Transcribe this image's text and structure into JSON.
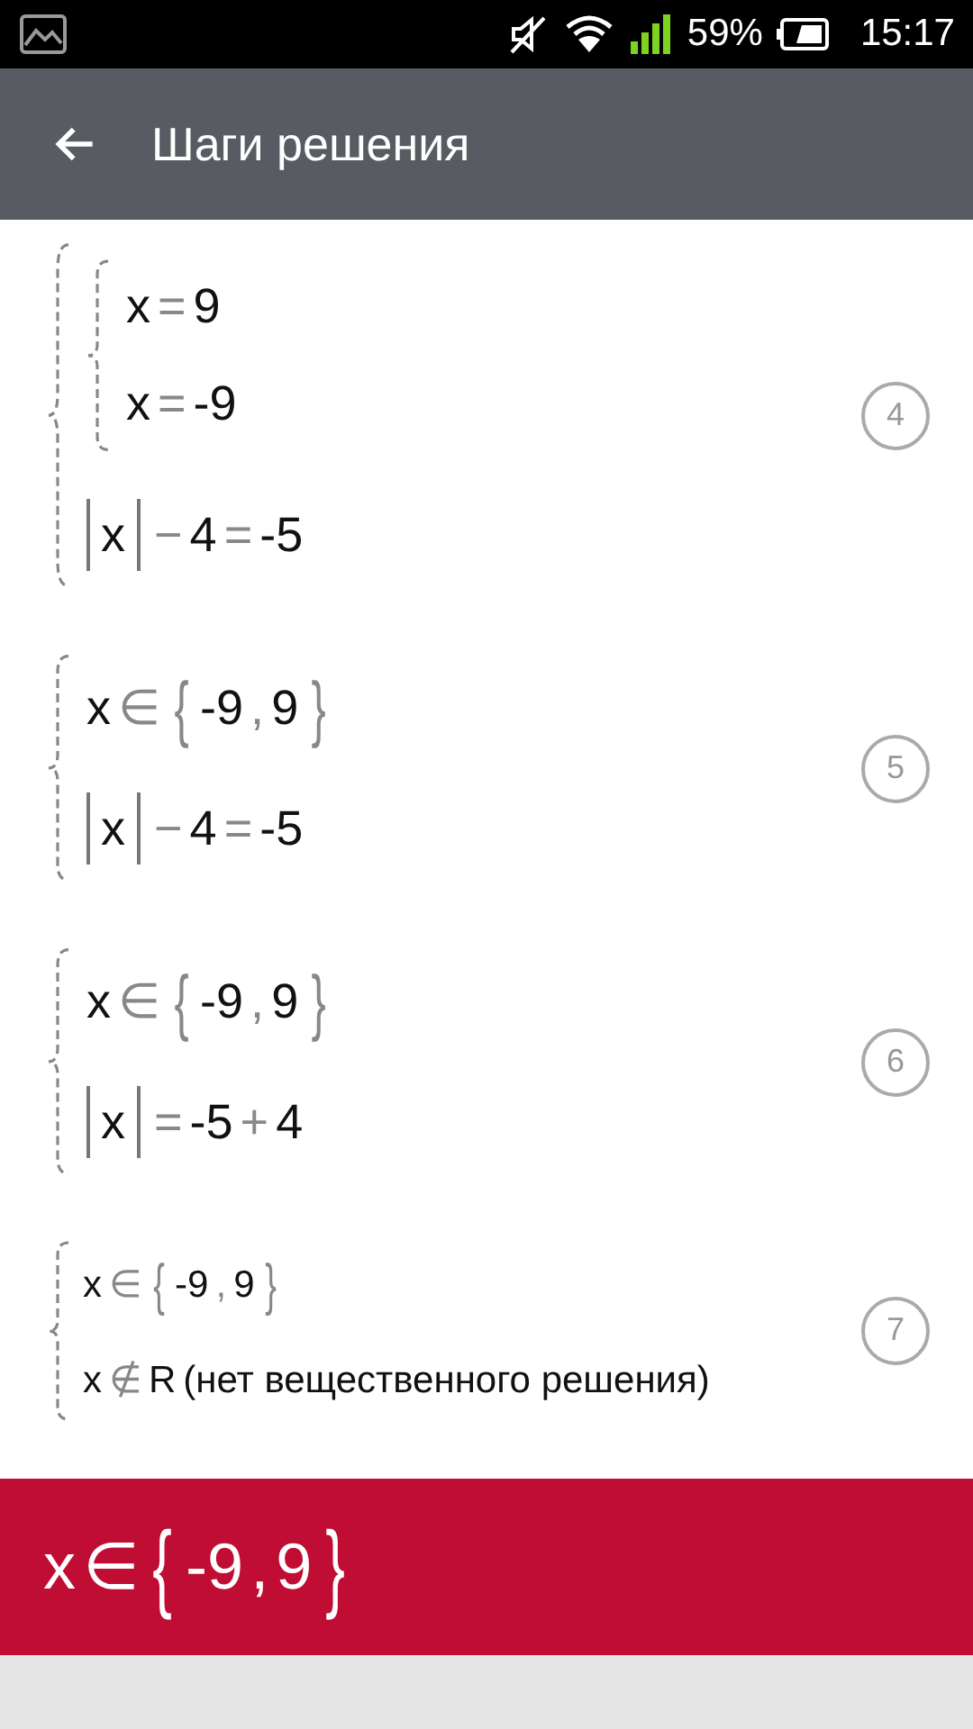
{
  "status_bar": {
    "battery": "59%",
    "time": "15:17"
  },
  "app_bar": {
    "title": "Шаги решения"
  },
  "steps": [
    {
      "number": "4",
      "compact": false,
      "body": {
        "kind": "system",
        "items": [
          {
            "kind": "system",
            "items": [
              {
                "kind": "line",
                "tokens": [
                  {
                    "kind": "term",
                    "text": "x"
                  },
                  {
                    "kind": "op",
                    "text": "="
                  },
                  {
                    "kind": "term",
                    "text": "9"
                  }
                ]
              },
              {
                "kind": "line",
                "tokens": [
                  {
                    "kind": "term",
                    "text": "x"
                  },
                  {
                    "kind": "op",
                    "text": "="
                  },
                  {
                    "kind": "term",
                    "text": "-9"
                  }
                ]
              }
            ]
          },
          {
            "kind": "line",
            "tokens": [
              {
                "kind": "abs",
                "text": "x"
              },
              {
                "kind": "op",
                "text": "−"
              },
              {
                "kind": "term",
                "text": "4"
              },
              {
                "kind": "op",
                "text": "="
              },
              {
                "kind": "term",
                "text": "-5"
              }
            ]
          }
        ]
      }
    },
    {
      "number": "5",
      "compact": false,
      "body": {
        "kind": "system",
        "items": [
          {
            "kind": "line",
            "tokens": [
              {
                "kind": "term",
                "text": "x"
              },
              {
                "kind": "op",
                "text": "∈"
              },
              {
                "kind": "brace",
                "text": "{"
              },
              {
                "kind": "term",
                "text": "-9"
              },
              {
                "kind": "op",
                "text": ","
              },
              {
                "kind": "term",
                "text": "9"
              },
              {
                "kind": "brace",
                "text": "}"
              }
            ]
          },
          {
            "kind": "line",
            "tokens": [
              {
                "kind": "abs",
                "text": "x"
              },
              {
                "kind": "op",
                "text": "−"
              },
              {
                "kind": "term",
                "text": "4"
              },
              {
                "kind": "op",
                "text": "="
              },
              {
                "kind": "term",
                "text": "-5"
              }
            ]
          }
        ]
      }
    },
    {
      "number": "6",
      "compact": false,
      "body": {
        "kind": "system",
        "items": [
          {
            "kind": "line",
            "tokens": [
              {
                "kind": "term",
                "text": "x"
              },
              {
                "kind": "op",
                "text": "∈"
              },
              {
                "kind": "brace",
                "text": "{"
              },
              {
                "kind": "term",
                "text": "-9"
              },
              {
                "kind": "op",
                "text": ","
              },
              {
                "kind": "term",
                "text": "9"
              },
              {
                "kind": "brace",
                "text": "}"
              }
            ]
          },
          {
            "kind": "line",
            "tokens": [
              {
                "kind": "abs",
                "text": "x"
              },
              {
                "kind": "op",
                "text": "="
              },
              {
                "kind": "term",
                "text": "-5"
              },
              {
                "kind": "op",
                "text": "+"
              },
              {
                "kind": "term",
                "text": "4"
              }
            ]
          }
        ]
      }
    },
    {
      "number": "7",
      "compact": true,
      "body": {
        "kind": "system",
        "items": [
          {
            "kind": "line",
            "tokens": [
              {
                "kind": "term",
                "text": "x"
              },
              {
                "kind": "op",
                "text": "∈"
              },
              {
                "kind": "brace",
                "text": "{"
              },
              {
                "kind": "term",
                "text": "-9"
              },
              {
                "kind": "op",
                "text": ","
              },
              {
                "kind": "term",
                "text": "9"
              },
              {
                "kind": "brace",
                "text": "}"
              }
            ]
          },
          {
            "kind": "line",
            "tokens": [
              {
                "kind": "term",
                "text": "x"
              },
              {
                "kind": "op",
                "text": "∉"
              },
              {
                "kind": "term",
                "text": "R"
              },
              {
                "kind": "term",
                "text": "(нет вещественного решения)"
              }
            ]
          }
        ]
      }
    }
  ],
  "answer": {
    "tokens": [
      {
        "kind": "term",
        "text": "x"
      },
      {
        "kind": "op",
        "text": "∈"
      },
      {
        "kind": "brace",
        "text": "{"
      },
      {
        "kind": "term",
        "text": "-9"
      },
      {
        "kind": "op",
        "text": ","
      },
      {
        "kind": "term",
        "text": "9"
      },
      {
        "kind": "brace",
        "text": "}"
      }
    ]
  }
}
